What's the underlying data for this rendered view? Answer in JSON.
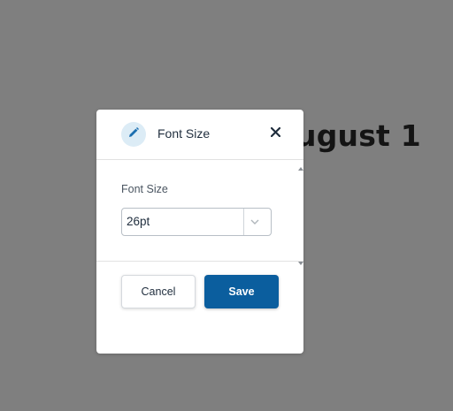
{
  "background": {
    "heading_text": "ugust 1",
    "overlay_color": "#7f7f7f"
  },
  "dialog": {
    "title": "Font Size",
    "title_icon": "pencil-icon",
    "close_icon": "close-icon",
    "field_label": "Font Size",
    "select": {
      "value": "26pt",
      "chevron_icon": "chevron-down-icon"
    },
    "buttons": {
      "cancel_label": "Cancel",
      "save_label": "Save"
    }
  },
  "colors": {
    "primary": "#0b5e9e",
    "icon_bg": "#dcecf6",
    "icon_fg": "#1b6fb0"
  }
}
